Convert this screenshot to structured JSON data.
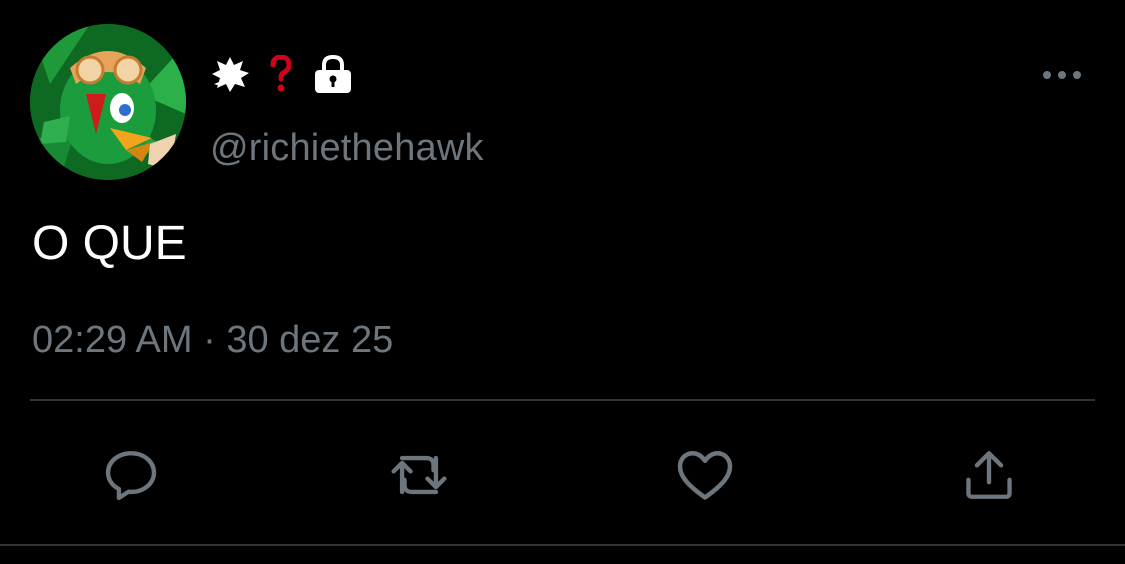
{
  "user": {
    "display_name_emojis": [
      "anger-puff-emoji",
      "red-question-mark-emoji"
    ],
    "locked_icon": "lock-icon",
    "handle": "@richiethehawk"
  },
  "tweet": {
    "text": "O QUE",
    "time": "02:29 AM",
    "separator": "·",
    "date": "30 dez 25",
    "meta_line": "02:29 AM · 30 dez 25"
  },
  "actions": {
    "icons": [
      "reply-icon",
      "retweet-icon",
      "like-icon",
      "share-icon"
    ]
  },
  "colors": {
    "background": "#000000",
    "primary_text": "#ffffff",
    "secondary_text": "#6e767d",
    "divider": "#2f3336",
    "icon": "#6e767d",
    "question_mark": "#d0021b"
  }
}
